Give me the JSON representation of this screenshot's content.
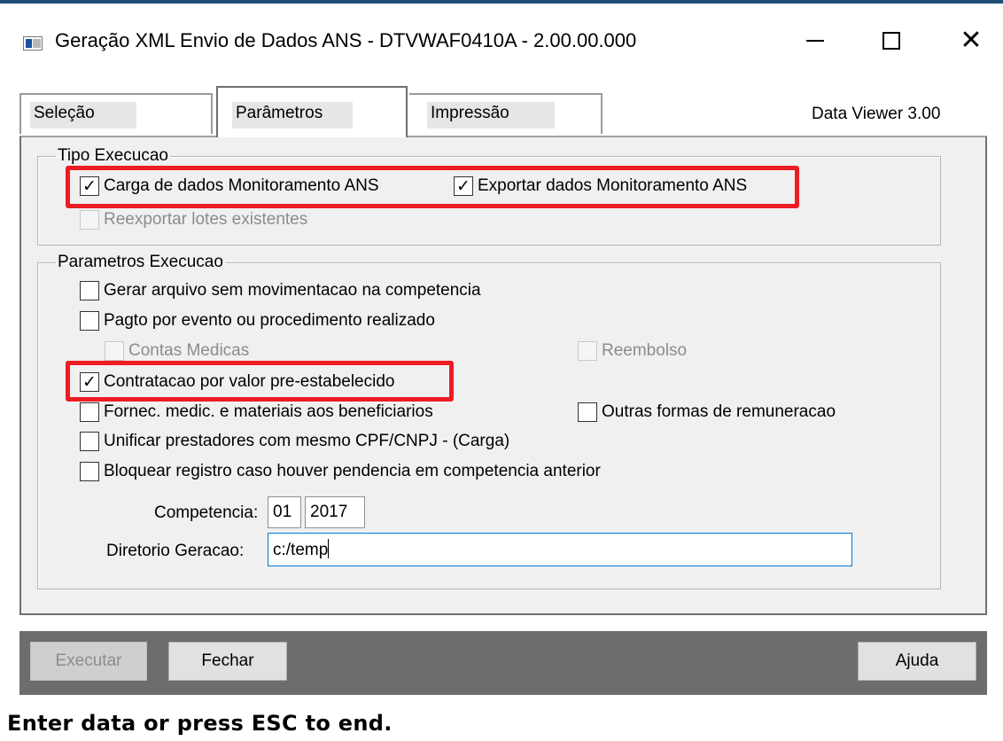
{
  "window": {
    "title": "Geração XML Envio de Dados ANS - DTVWAF0410A - 2.00.00.000",
    "controls": {
      "minimize": "—",
      "maximize": "☐",
      "close": "✕"
    },
    "accent": "#1f4e79"
  },
  "tabs": [
    {
      "label": "Seleção",
      "active": false
    },
    {
      "label": "Parâmetros",
      "active": true
    },
    {
      "label": "Impressão",
      "active": false
    }
  ],
  "viewer_version": "Data Viewer 3.00",
  "tipo_execucao": {
    "legend": "Tipo Execucao",
    "carga": {
      "label": "Carga de dados Monitoramento ANS",
      "checked": true,
      "enabled": true
    },
    "exportar": {
      "label": "Exportar dados Monitoramento ANS",
      "checked": true,
      "enabled": true
    },
    "reexportar": {
      "label": "Reexportar lotes existentes",
      "checked": false,
      "enabled": false
    }
  },
  "parametros_execucao": {
    "legend": "Parametros Execucao",
    "gerar_sem_mov": {
      "label": "Gerar arquivo sem movimentacao na competencia",
      "checked": false,
      "enabled": true
    },
    "pagto_evento": {
      "label": "Pagto por evento ou procedimento realizado",
      "checked": false,
      "enabled": true
    },
    "contas_medicas": {
      "label": "Contas Medicas",
      "checked": false,
      "enabled": false
    },
    "reembolso": {
      "label": "Reembolso",
      "checked": false,
      "enabled": false
    },
    "contratacao": {
      "label": "Contratacao por valor pre-estabelecido",
      "checked": true,
      "enabled": true
    },
    "fornec_medic": {
      "label": "Fornec. medic. e materiais aos beneficiarios",
      "checked": false,
      "enabled": true
    },
    "outras_formas": {
      "label": "Outras formas de remuneracao",
      "checked": false,
      "enabled": true
    },
    "unificar": {
      "label": "Unificar prestadores com mesmo CPF/CNPJ - (Carga)",
      "checked": false,
      "enabled": true
    },
    "bloquear": {
      "label": "Bloquear registro caso houver pendencia em competencia anterior",
      "checked": false,
      "enabled": true
    },
    "competencia": {
      "label": "Competencia:",
      "month": "01",
      "year": "2017"
    },
    "diretorio": {
      "label": "Diretorio Geracao:",
      "value": "c:/temp"
    }
  },
  "highlight_color": "#ee1c24",
  "buttons": {
    "executar": {
      "label": "Executar",
      "enabled": false
    },
    "fechar": {
      "label": "Fechar",
      "enabled": true
    },
    "ajuda": {
      "label": "Ajuda",
      "enabled": true
    }
  },
  "status_text": "Enter data or press ESC to end."
}
